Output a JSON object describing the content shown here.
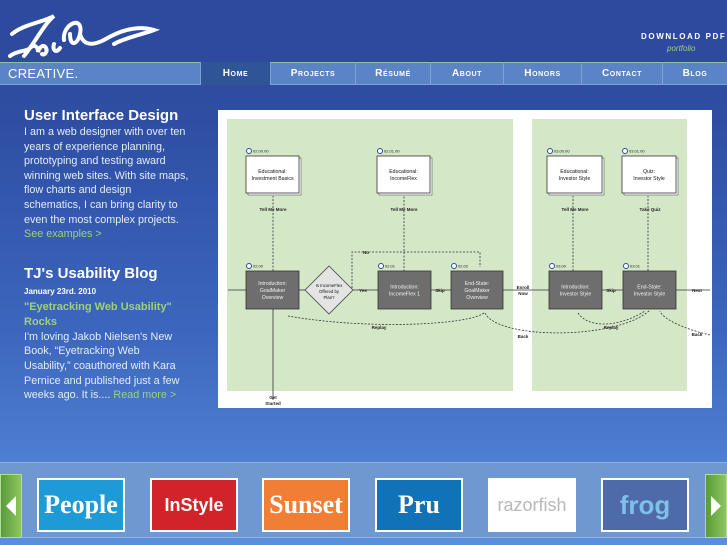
{
  "header": {
    "logo_text": "TobiPo",
    "tagline": "CREATIVE.",
    "download": "DOWNLOAD PDF",
    "portfolio": "portfolio"
  },
  "nav": [
    "Home",
    "Projects",
    "Résumé",
    "About",
    "Honors",
    "Contact",
    "Blog"
  ],
  "intro": {
    "title": "User Interface Design",
    "body": "I am a web designer with over ten years of experience planning, prototyping and testing award winning web sites. With site maps, flow charts and design schematics, I can bring clarity to even the most complex projects.",
    "link": "See examples >"
  },
  "blog": {
    "title": "TJ's Usability Blog",
    "date": "January 23rd. 2010",
    "post_title": "\"Eyetracking Web Usability\" Rocks",
    "excerpt": "I'm loving Jakob Nielsen's New Book, “Eyetracking Web Usability,” coauthored with Kara Pernice and published just a few weeks ago. It is.... ",
    "link": "Read more >"
  },
  "diagram": {
    "ids": [
      "02.00.00",
      "02.01.00",
      "03.00.00",
      "03.01.00",
      "02.00",
      "02.01",
      "02.02",
      "03.00",
      "03.01"
    ],
    "boxes": [
      [
        "Educational:",
        "Investment Basics"
      ],
      [
        "Educational:",
        "IncomeFlex"
      ],
      [
        "Educational:",
        "Investor Style"
      ],
      [
        "Quiz:",
        "Investor Style"
      ],
      [
        "Introduction:",
        "GoalMaker",
        "Overview"
      ],
      [
        "Introduction:",
        "IncomeFlex 1"
      ],
      [
        "End-State:",
        "GoalMaker",
        "Overview"
      ],
      [
        "Introduction:",
        "Investor Style"
      ],
      [
        "End-State:",
        "Investor Style"
      ]
    ],
    "decision": [
      "Is IncomeFlex",
      "Offered by",
      "Plan?"
    ],
    "labels": {
      "tell1": "Tell Me More",
      "tell2": "Tell Me More",
      "tell3": "Tell Me More",
      "quiz": "Take Quiz",
      "no": "No",
      "yes": "Yes",
      "skip1": "Skip",
      "skip2": "Skip",
      "enroll1": "Enroll",
      "enroll2": "Now",
      "next": "Next",
      "replay1": "Replay",
      "replay2": "Replay",
      "back1": "Back",
      "back2": "Back",
      "get1": "Get",
      "get2": "Started"
    }
  },
  "carousel": {
    "logos": [
      {
        "name": "People",
        "bg": "#1e9ad6",
        "fg": "#fff"
      },
      {
        "name": "InStyle",
        "bg": "#d3232a",
        "fg": "#fff"
      },
      {
        "name": "Sunset",
        "bg": "#f07e35",
        "fg": "#fff"
      },
      {
        "name": "Pru",
        "bg": "#1172b7",
        "fg": "#fff"
      },
      {
        "name": "razorfish",
        "bg": "#ffffff",
        "fg": "#b8b8b8"
      },
      {
        "name": "frog",
        "bg": "#4e6aa8",
        "fg": "#7fc0e8"
      }
    ]
  }
}
